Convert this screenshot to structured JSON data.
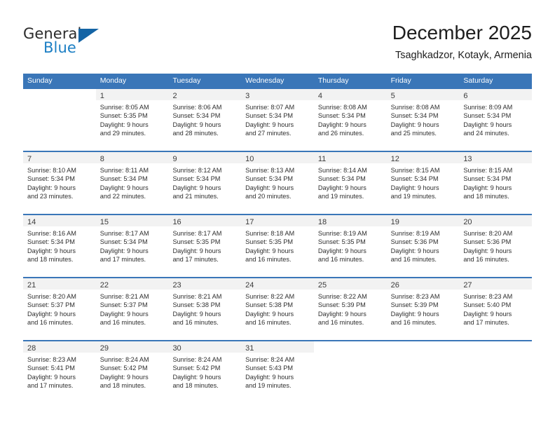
{
  "brand": {
    "name_top": "General",
    "name_bottom": "Blue",
    "color_dark": "#2b2b2b",
    "color_blue": "#1c7fc4",
    "triangle_color": "#1464a5"
  },
  "header": {
    "title": "December 2025",
    "subtitle": "Tsaghkadzor, Kotayk, Armenia"
  },
  "theme": {
    "header_blue": "#3a76b8",
    "day_band_gray": "#f2f2f2",
    "text": "#2e2e2e"
  },
  "calendar": {
    "weekdays": [
      "Sunday",
      "Monday",
      "Tuesday",
      "Wednesday",
      "Thursday",
      "Friday",
      "Saturday"
    ],
    "weeks": [
      [
        {
          "day": "",
          "lines": []
        },
        {
          "day": "1",
          "lines": [
            "Sunrise: 8:05 AM",
            "Sunset: 5:35 PM",
            "Daylight: 9 hours",
            "and 29 minutes."
          ]
        },
        {
          "day": "2",
          "lines": [
            "Sunrise: 8:06 AM",
            "Sunset: 5:34 PM",
            "Daylight: 9 hours",
            "and 28 minutes."
          ]
        },
        {
          "day": "3",
          "lines": [
            "Sunrise: 8:07 AM",
            "Sunset: 5:34 PM",
            "Daylight: 9 hours",
            "and 27 minutes."
          ]
        },
        {
          "day": "4",
          "lines": [
            "Sunrise: 8:08 AM",
            "Sunset: 5:34 PM",
            "Daylight: 9 hours",
            "and 26 minutes."
          ]
        },
        {
          "day": "5",
          "lines": [
            "Sunrise: 8:08 AM",
            "Sunset: 5:34 PM",
            "Daylight: 9 hours",
            "and 25 minutes."
          ]
        },
        {
          "day": "6",
          "lines": [
            "Sunrise: 8:09 AM",
            "Sunset: 5:34 PM",
            "Daylight: 9 hours",
            "and 24 minutes."
          ]
        }
      ],
      [
        {
          "day": "7",
          "lines": [
            "Sunrise: 8:10 AM",
            "Sunset: 5:34 PM",
            "Daylight: 9 hours",
            "and 23 minutes."
          ]
        },
        {
          "day": "8",
          "lines": [
            "Sunrise: 8:11 AM",
            "Sunset: 5:34 PM",
            "Daylight: 9 hours",
            "and 22 minutes."
          ]
        },
        {
          "day": "9",
          "lines": [
            "Sunrise: 8:12 AM",
            "Sunset: 5:34 PM",
            "Daylight: 9 hours",
            "and 21 minutes."
          ]
        },
        {
          "day": "10",
          "lines": [
            "Sunrise: 8:13 AM",
            "Sunset: 5:34 PM",
            "Daylight: 9 hours",
            "and 20 minutes."
          ]
        },
        {
          "day": "11",
          "lines": [
            "Sunrise: 8:14 AM",
            "Sunset: 5:34 PM",
            "Daylight: 9 hours",
            "and 19 minutes."
          ]
        },
        {
          "day": "12",
          "lines": [
            "Sunrise: 8:15 AM",
            "Sunset: 5:34 PM",
            "Daylight: 9 hours",
            "and 19 minutes."
          ]
        },
        {
          "day": "13",
          "lines": [
            "Sunrise: 8:15 AM",
            "Sunset: 5:34 PM",
            "Daylight: 9 hours",
            "and 18 minutes."
          ]
        }
      ],
      [
        {
          "day": "14",
          "lines": [
            "Sunrise: 8:16 AM",
            "Sunset: 5:34 PM",
            "Daylight: 9 hours",
            "and 18 minutes."
          ]
        },
        {
          "day": "15",
          "lines": [
            "Sunrise: 8:17 AM",
            "Sunset: 5:34 PM",
            "Daylight: 9 hours",
            "and 17 minutes."
          ]
        },
        {
          "day": "16",
          "lines": [
            "Sunrise: 8:17 AM",
            "Sunset: 5:35 PM",
            "Daylight: 9 hours",
            "and 17 minutes."
          ]
        },
        {
          "day": "17",
          "lines": [
            "Sunrise: 8:18 AM",
            "Sunset: 5:35 PM",
            "Daylight: 9 hours",
            "and 16 minutes."
          ]
        },
        {
          "day": "18",
          "lines": [
            "Sunrise: 8:19 AM",
            "Sunset: 5:35 PM",
            "Daylight: 9 hours",
            "and 16 minutes."
          ]
        },
        {
          "day": "19",
          "lines": [
            "Sunrise: 8:19 AM",
            "Sunset: 5:36 PM",
            "Daylight: 9 hours",
            "and 16 minutes."
          ]
        },
        {
          "day": "20",
          "lines": [
            "Sunrise: 8:20 AM",
            "Sunset: 5:36 PM",
            "Daylight: 9 hours",
            "and 16 minutes."
          ]
        }
      ],
      [
        {
          "day": "21",
          "lines": [
            "Sunrise: 8:20 AM",
            "Sunset: 5:37 PM",
            "Daylight: 9 hours",
            "and 16 minutes."
          ]
        },
        {
          "day": "22",
          "lines": [
            "Sunrise: 8:21 AM",
            "Sunset: 5:37 PM",
            "Daylight: 9 hours",
            "and 16 minutes."
          ]
        },
        {
          "day": "23",
          "lines": [
            "Sunrise: 8:21 AM",
            "Sunset: 5:38 PM",
            "Daylight: 9 hours",
            "and 16 minutes."
          ]
        },
        {
          "day": "24",
          "lines": [
            "Sunrise: 8:22 AM",
            "Sunset: 5:38 PM",
            "Daylight: 9 hours",
            "and 16 minutes."
          ]
        },
        {
          "day": "25",
          "lines": [
            "Sunrise: 8:22 AM",
            "Sunset: 5:39 PM",
            "Daylight: 9 hours",
            "and 16 minutes."
          ]
        },
        {
          "day": "26",
          "lines": [
            "Sunrise: 8:23 AM",
            "Sunset: 5:39 PM",
            "Daylight: 9 hours",
            "and 16 minutes."
          ]
        },
        {
          "day": "27",
          "lines": [
            "Sunrise: 8:23 AM",
            "Sunset: 5:40 PM",
            "Daylight: 9 hours",
            "and 17 minutes."
          ]
        }
      ],
      [
        {
          "day": "28",
          "lines": [
            "Sunrise: 8:23 AM",
            "Sunset: 5:41 PM",
            "Daylight: 9 hours",
            "and 17 minutes."
          ]
        },
        {
          "day": "29",
          "lines": [
            "Sunrise: 8:24 AM",
            "Sunset: 5:42 PM",
            "Daylight: 9 hours",
            "and 18 minutes."
          ]
        },
        {
          "day": "30",
          "lines": [
            "Sunrise: 8:24 AM",
            "Sunset: 5:42 PM",
            "Daylight: 9 hours",
            "and 18 minutes."
          ]
        },
        {
          "day": "31",
          "lines": [
            "Sunrise: 8:24 AM",
            "Sunset: 5:43 PM",
            "Daylight: 9 hours",
            "and 19 minutes."
          ]
        },
        {
          "day": "",
          "lines": []
        },
        {
          "day": "",
          "lines": []
        },
        {
          "day": "",
          "lines": []
        }
      ]
    ]
  }
}
